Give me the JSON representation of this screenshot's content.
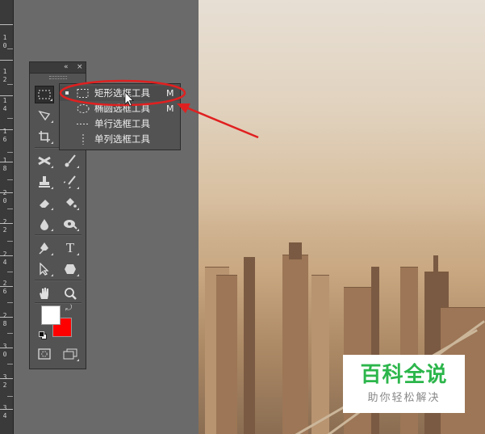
{
  "ruler": {
    "labels": [
      "1",
      "0",
      "1",
      "2",
      "1",
      "4",
      "1",
      "6",
      "1",
      "8",
      "2",
      "0",
      "2",
      "2",
      "2",
      "4",
      "2",
      "6",
      "2",
      "8",
      "3",
      "0",
      "3",
      "2",
      "3",
      "4"
    ]
  },
  "toolbox": {
    "collapse_glyph": "«",
    "close_glyph": "×",
    "tools": [
      {
        "name": "rectangular-marquee-tool",
        "icon": "rect-marquee-icon"
      },
      {
        "name": "lasso-tool",
        "icon": "lasso-icon"
      },
      {
        "name": "crop-tool",
        "icon": "crop-icon"
      },
      {
        "name": "spot-healing-tool",
        "icon": "bandage-icon"
      },
      {
        "name": "brush-tool",
        "icon": "brush-icon"
      },
      {
        "name": "clone-stamp-tool",
        "icon": "stamp-icon"
      },
      {
        "name": "history-brush-tool",
        "icon": "history-brush-icon"
      },
      {
        "name": "eraser-tool",
        "icon": "eraser-icon"
      },
      {
        "name": "paint-bucket-tool",
        "icon": "paint-bucket-icon"
      },
      {
        "name": "blur-tool",
        "icon": "drop-icon"
      },
      {
        "name": "dodge-tool",
        "icon": "dodge-icon"
      },
      {
        "name": "pen-tool",
        "icon": "pen-icon"
      },
      {
        "name": "type-tool",
        "icon": "type-icon",
        "glyph": "T"
      },
      {
        "name": "path-selection-tool",
        "icon": "arrow-icon"
      },
      {
        "name": "shape-tool",
        "icon": "hexagon-icon"
      },
      {
        "name": "hand-tool",
        "icon": "hand-icon"
      },
      {
        "name": "zoom-tool",
        "icon": "magnifier-icon"
      },
      {
        "name": "quick-mask",
        "icon": "quick-mask-icon"
      },
      {
        "name": "screen-mode",
        "icon": "screen-mode-icon"
      }
    ],
    "colors": {
      "foreground": "#ffffff",
      "background": "#ff0000"
    }
  },
  "flyout": {
    "items": [
      {
        "label": "矩形选框工具",
        "shortcut": "M",
        "icon": "rect-marquee-icon",
        "selected": true
      },
      {
        "label": "椭圆选框工具",
        "shortcut": "M",
        "icon": "ellipse-marquee-icon",
        "selected": false
      },
      {
        "label": "单行选框工具",
        "shortcut": "",
        "icon": "single-row-marquee-icon",
        "selected": false
      },
      {
        "label": "单列选框工具",
        "shortcut": "",
        "icon": "single-column-marquee-icon",
        "selected": false
      }
    ]
  },
  "annotation": {
    "color": "#e02020"
  },
  "watermark": {
    "title": "百科全说",
    "subtitle": "助你轻松解决",
    "title_color": "#2cb64b"
  }
}
